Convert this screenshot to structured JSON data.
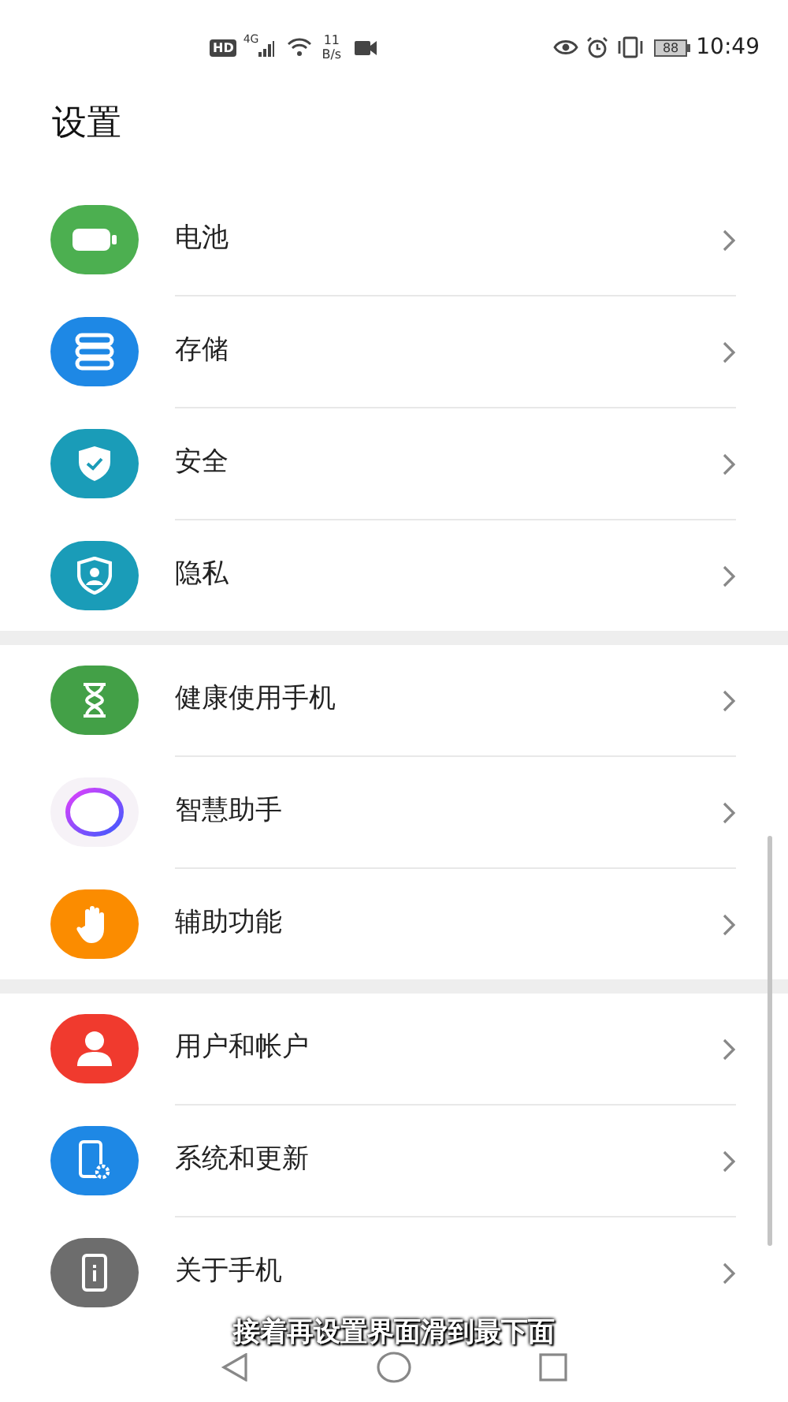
{
  "status_bar": {
    "hd": "HD",
    "network": "4G",
    "speed_value": "11",
    "speed_unit": "B/s",
    "battery": "88",
    "time": "10:49"
  },
  "title": "设置",
  "groups": [
    {
      "items": [
        {
          "label": "电池",
          "kind": "battery"
        },
        {
          "label": "存储",
          "kind": "storage"
        },
        {
          "label": "安全",
          "kind": "security"
        },
        {
          "label": "隐私",
          "kind": "privacy"
        }
      ]
    },
    {
      "items": [
        {
          "label": "健康使用手机",
          "kind": "hourglass"
        },
        {
          "label": "智慧助手",
          "kind": "assistant"
        },
        {
          "label": "辅助功能",
          "kind": "hand"
        }
      ]
    },
    {
      "items": [
        {
          "label": "用户和帐户",
          "kind": "user"
        },
        {
          "label": "系统和更新",
          "kind": "system"
        },
        {
          "label": "关于手机",
          "kind": "about"
        }
      ]
    }
  ],
  "caption": "接着再设置界面滑到最下面"
}
